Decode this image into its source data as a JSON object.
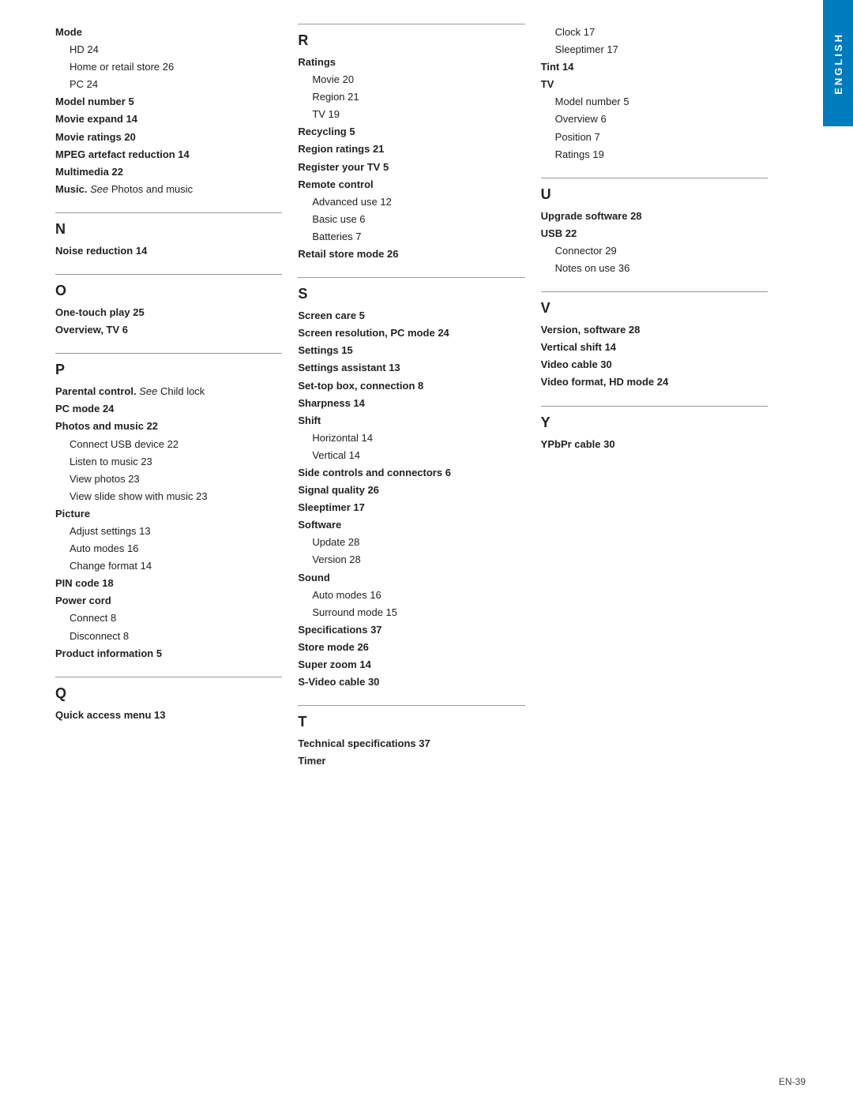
{
  "sidetab": {
    "label": "ENGLISH"
  },
  "footer": {
    "text": "EN-39"
  },
  "columns": [
    {
      "id": "col1",
      "sections": [
        {
          "letter": null,
          "divider": false,
          "entries": [
            {
              "text": "Mode",
              "bold": true,
              "indent": 0
            },
            {
              "text": "HD  24",
              "bold": false,
              "indent": 1
            },
            {
              "text": "Home or retail store  26",
              "bold": false,
              "indent": 1
            },
            {
              "text": "PC  24",
              "bold": false,
              "indent": 1
            },
            {
              "text": "Model number  5",
              "bold": true,
              "indent": 0
            },
            {
              "text": "Movie expand  14",
              "bold": true,
              "indent": 0
            },
            {
              "text": "Movie ratings  20",
              "bold": true,
              "indent": 0
            },
            {
              "text": "MPEG artefact reduction  14",
              "bold": true,
              "indent": 0
            },
            {
              "text": "Multimedia  22",
              "bold": true,
              "indent": 0
            },
            {
              "text": "Music. ",
              "bold": true,
              "indent": 0,
              "italic_suffix": "See",
              "suffix": " Photos and music"
            }
          ]
        },
        {
          "letter": "N",
          "divider": true,
          "entries": [
            {
              "text": "Noise reduction  14",
              "bold": true,
              "indent": 0
            }
          ]
        },
        {
          "letter": "O",
          "divider": true,
          "entries": [
            {
              "text": "One-touch play  25",
              "bold": true,
              "indent": 0
            },
            {
              "text": "Overview, TV  6",
              "bold": true,
              "indent": 0
            }
          ]
        },
        {
          "letter": "P",
          "divider": true,
          "entries": [
            {
              "text": "Parental control. ",
              "bold": true,
              "indent": 0,
              "italic_suffix": "See",
              "suffix": " Child lock"
            },
            {
              "text": "PC mode  24",
              "bold": true,
              "indent": 0
            },
            {
              "text": "Photos and music  22",
              "bold": true,
              "indent": 0
            },
            {
              "text": "Connect USB device  22",
              "bold": false,
              "indent": 1
            },
            {
              "text": "Listen to music  23",
              "bold": false,
              "indent": 1
            },
            {
              "text": "View photos  23",
              "bold": false,
              "indent": 1
            },
            {
              "text": "View slide show with music  23",
              "bold": false,
              "indent": 1
            },
            {
              "text": "Picture",
              "bold": true,
              "indent": 0
            },
            {
              "text": "Adjust settings  13",
              "bold": false,
              "indent": 1
            },
            {
              "text": "Auto modes  16",
              "bold": false,
              "indent": 1
            },
            {
              "text": "Change format  14",
              "bold": false,
              "indent": 1
            },
            {
              "text": "PIN code  18",
              "bold": true,
              "indent": 0
            },
            {
              "text": "Power cord",
              "bold": true,
              "indent": 0
            },
            {
              "text": "Connect  8",
              "bold": false,
              "indent": 1
            },
            {
              "text": "Disconnect  8",
              "bold": false,
              "indent": 1
            },
            {
              "text": "Product information  5",
              "bold": true,
              "indent": 0
            }
          ]
        },
        {
          "letter": "Q",
          "divider": true,
          "entries": [
            {
              "text": "Quick access menu  13",
              "bold": true,
              "indent": 0
            }
          ]
        }
      ]
    },
    {
      "id": "col2",
      "sections": [
        {
          "letter": "R",
          "divider": true,
          "entries": [
            {
              "text": "Ratings",
              "bold": true,
              "indent": 0
            },
            {
              "text": "Movie  20",
              "bold": false,
              "indent": 1
            },
            {
              "text": "Region  21",
              "bold": false,
              "indent": 1
            },
            {
              "text": "TV  19",
              "bold": false,
              "indent": 1
            },
            {
              "text": "Recycling  5",
              "bold": true,
              "indent": 0
            },
            {
              "text": "Region ratings  21",
              "bold": true,
              "indent": 0
            },
            {
              "text": "Register your TV  5",
              "bold": true,
              "indent": 0
            },
            {
              "text": "Remote control",
              "bold": true,
              "indent": 0
            },
            {
              "text": "Advanced use  12",
              "bold": false,
              "indent": 1
            },
            {
              "text": "Basic use  6",
              "bold": false,
              "indent": 1
            },
            {
              "text": "Batteries  7",
              "bold": false,
              "indent": 1
            },
            {
              "text": "Retail store mode  26",
              "bold": true,
              "indent": 0
            }
          ]
        },
        {
          "letter": "S",
          "divider": true,
          "entries": [
            {
              "text": "Screen care  5",
              "bold": true,
              "indent": 0
            },
            {
              "text": "Screen resolution, PC mode  24",
              "bold": true,
              "indent": 0
            },
            {
              "text": "Settings  15",
              "bold": true,
              "indent": 0
            },
            {
              "text": "Settings assistant  13",
              "bold": true,
              "indent": 0
            },
            {
              "text": "Set-top box, connection  8",
              "bold": true,
              "indent": 0
            },
            {
              "text": "Sharpness  14",
              "bold": true,
              "indent": 0
            },
            {
              "text": "Shift",
              "bold": true,
              "indent": 0
            },
            {
              "text": "Horizontal  14",
              "bold": false,
              "indent": 1
            },
            {
              "text": "Vertical  14",
              "bold": false,
              "indent": 1
            },
            {
              "text": "Side controls and connectors  6",
              "bold": true,
              "indent": 0
            },
            {
              "text": "Signal quality  26",
              "bold": true,
              "indent": 0
            },
            {
              "text": "Sleeptimer  17",
              "bold": true,
              "indent": 0
            },
            {
              "text": "Software",
              "bold": true,
              "indent": 0
            },
            {
              "text": "Update  28",
              "bold": false,
              "indent": 1
            },
            {
              "text": "Version  28",
              "bold": false,
              "indent": 1
            },
            {
              "text": "Sound",
              "bold": true,
              "indent": 0
            },
            {
              "text": "Auto modes  16",
              "bold": false,
              "indent": 1
            },
            {
              "text": "Surround mode  15",
              "bold": false,
              "indent": 1
            },
            {
              "text": "Specifications  37",
              "bold": true,
              "indent": 0
            },
            {
              "text": "Store mode  26",
              "bold": true,
              "indent": 0
            },
            {
              "text": "Super zoom  14",
              "bold": true,
              "indent": 0
            },
            {
              "text": "S-Video cable  30",
              "bold": true,
              "indent": 0
            }
          ]
        },
        {
          "letter": "T",
          "divider": true,
          "entries": [
            {
              "text": "Technical specifications  37",
              "bold": true,
              "indent": 0
            },
            {
              "text": "Timer",
              "bold": true,
              "indent": 0
            }
          ]
        }
      ]
    },
    {
      "id": "col3",
      "sections": [
        {
          "letter": null,
          "divider": false,
          "entries": [
            {
              "text": "Clock  17",
              "bold": false,
              "indent": 1
            },
            {
              "text": "Sleeptimer  17",
              "bold": false,
              "indent": 1
            },
            {
              "text": "Tint  14",
              "bold": true,
              "indent": 0
            },
            {
              "text": "TV",
              "bold": true,
              "indent": 0
            },
            {
              "text": "Model number  5",
              "bold": false,
              "indent": 1
            },
            {
              "text": "Overview  6",
              "bold": false,
              "indent": 1
            },
            {
              "text": "Position  7",
              "bold": false,
              "indent": 1
            },
            {
              "text": "Ratings  19",
              "bold": false,
              "indent": 1
            }
          ]
        },
        {
          "letter": "U",
          "divider": true,
          "entries": [
            {
              "text": "Upgrade software  28",
              "bold": true,
              "indent": 0
            },
            {
              "text": "USB  22",
              "bold": true,
              "indent": 0
            },
            {
              "text": "Connector  29",
              "bold": false,
              "indent": 1
            },
            {
              "text": "Notes on use  36",
              "bold": false,
              "indent": 1
            }
          ]
        },
        {
          "letter": "V",
          "divider": true,
          "entries": [
            {
              "text": "Version, software  28",
              "bold": true,
              "indent": 0
            },
            {
              "text": "Vertical shift  14",
              "bold": true,
              "indent": 0
            },
            {
              "text": "Video cable  30",
              "bold": true,
              "indent": 0
            },
            {
              "text": "Video format, HD mode  24",
              "bold": true,
              "indent": 0
            }
          ]
        },
        {
          "letter": "Y",
          "divider": true,
          "entries": [
            {
              "text": "YPbPr cable  30",
              "bold": true,
              "indent": 0
            }
          ]
        }
      ]
    }
  ]
}
